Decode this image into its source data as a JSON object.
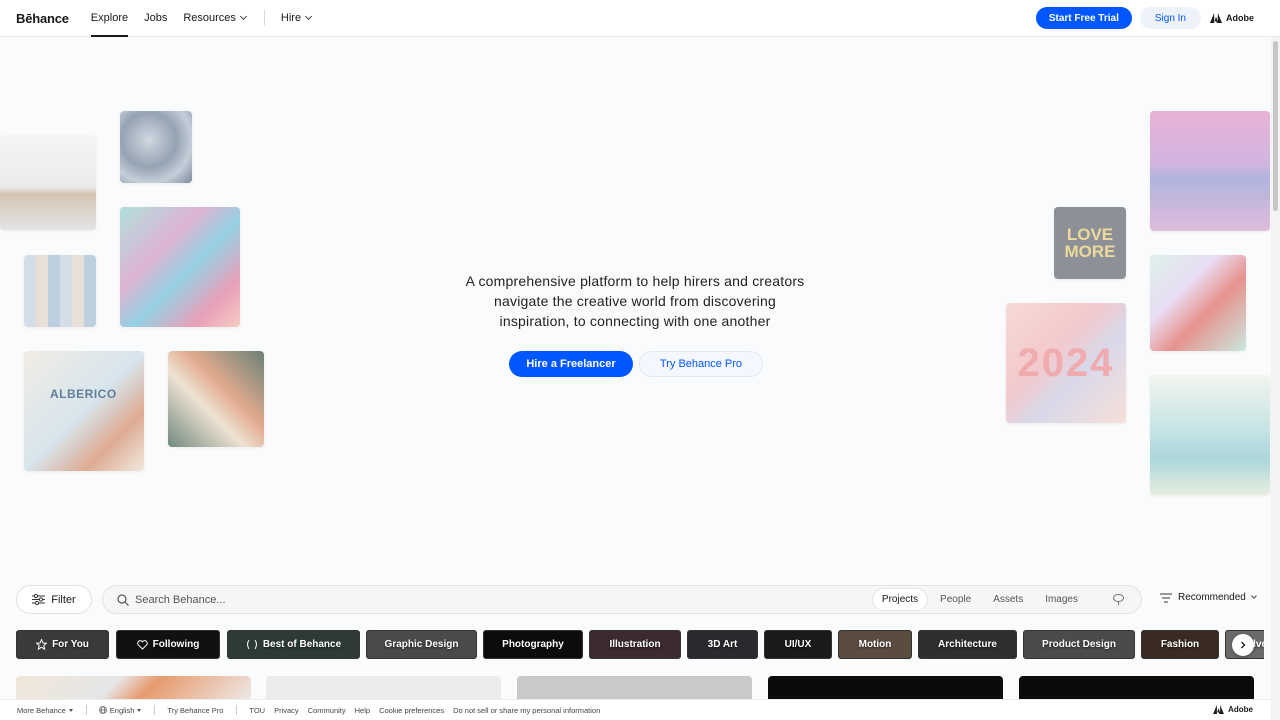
{
  "header": {
    "logo": "Bēhance",
    "nav": [
      {
        "label": "Explore",
        "active": true
      },
      {
        "label": "Jobs",
        "active": false
      },
      {
        "label": "Resources",
        "active": false,
        "dropdown": true
      },
      {
        "label": "Hire",
        "active": false,
        "dropdown": true
      }
    ],
    "start_trial": "Start Free Trial",
    "sign_in": "Sign In",
    "adobe": "Adobe"
  },
  "hero": {
    "tagline_line1": "A comprehensive platform to help hirers and creators",
    "tagline_line2": "navigate the creative world from discovering",
    "tagline_line3": "inspiration, to connecting with one another",
    "hire_button": "Hire a Freelancer",
    "pro_button": "Try Behance Pro",
    "thumb_labels": {
      "alberico": "ALBERICO",
      "love_more": "LOVE MORE",
      "year": "2024"
    }
  },
  "search": {
    "filter_label": "Filter",
    "placeholder": "Search Behance...",
    "tabs": [
      {
        "label": "Projects",
        "active": true
      },
      {
        "label": "People",
        "active": false
      },
      {
        "label": "Assets",
        "active": false
      },
      {
        "label": "Images",
        "active": false
      }
    ],
    "sort_label": "Recommended"
  },
  "categories": [
    {
      "label": "For You",
      "icon": "star-icon",
      "color": "#3a3a3a"
    },
    {
      "label": "Following",
      "icon": "heart-icon",
      "color": "#111111"
    },
    {
      "label": "Best of Behance",
      "icon": "laurel-icon",
      "color": "#2d3a36"
    },
    {
      "label": "Graphic Design",
      "icon": "",
      "color": "#4a4a4a"
    },
    {
      "label": "Photography",
      "icon": "",
      "color": "#0c0c0c"
    },
    {
      "label": "Illustration",
      "icon": "",
      "color": "#3b2a30"
    },
    {
      "label": "3D Art",
      "icon": "",
      "color": "#2a2a2e"
    },
    {
      "label": "UI/UX",
      "icon": "",
      "color": "#1a1a1a"
    },
    {
      "label": "Motion",
      "icon": "",
      "color": "#5a4d40"
    },
    {
      "label": "Architecture",
      "icon": "",
      "color": "#2f2f2f"
    },
    {
      "label": "Product Design",
      "icon": "",
      "color": "#4b4b4b"
    },
    {
      "label": "Fashion",
      "icon": "",
      "color": "#3a2b22"
    },
    {
      "label": "Advertising",
      "icon": "",
      "color": "#6a6a6a"
    }
  ],
  "footer": {
    "more_behance": "More Behance",
    "language": "English",
    "try_pro": "Try Behance Pro",
    "links": [
      "TOU",
      "Privacy",
      "Community",
      "Help",
      "Cookie preferences",
      "Do not sell or share my personal information"
    ],
    "adobe": "Adobe"
  },
  "colors": {
    "brand_blue": "#0057ff",
    "text": "#191919",
    "background": "#fafbfd"
  }
}
